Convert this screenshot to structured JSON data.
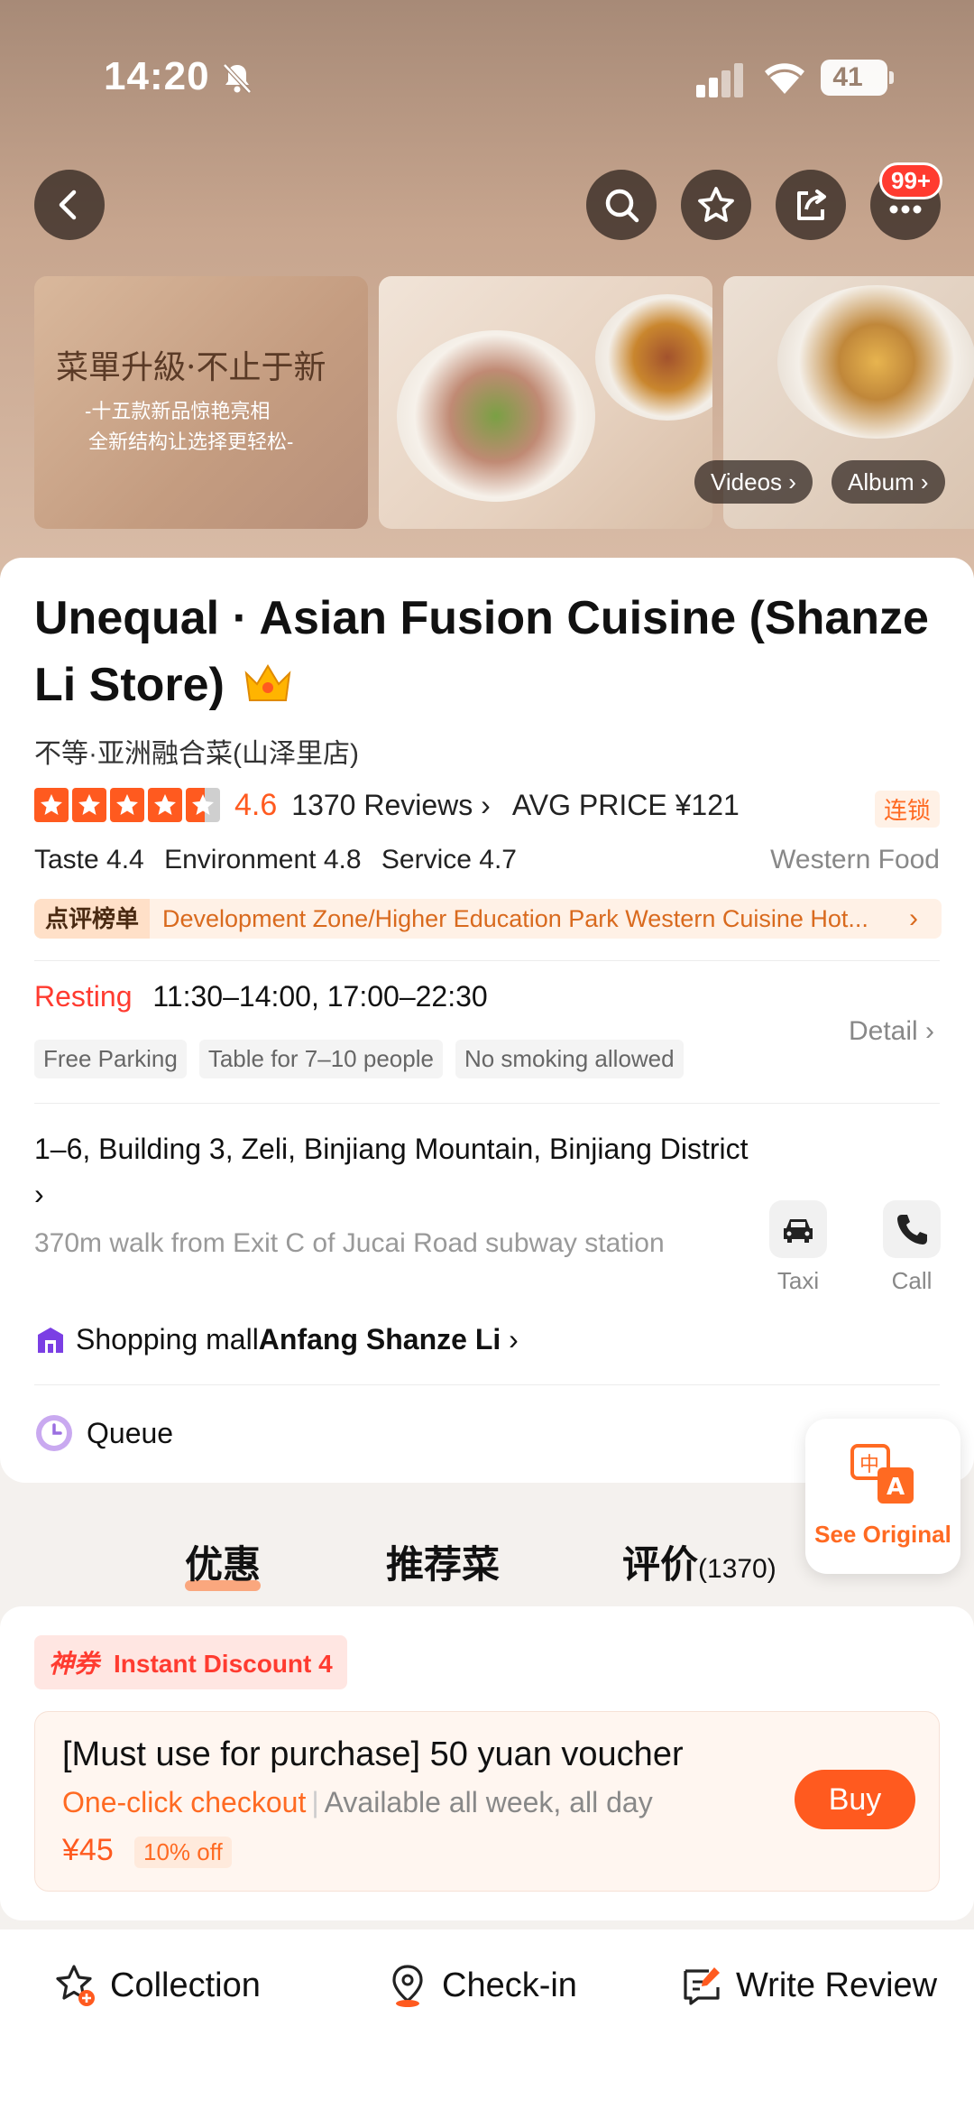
{
  "status_bar": {
    "time": "14:20",
    "battery": "41"
  },
  "header": {
    "more_badge": "99+"
  },
  "gallery": {
    "photo1_title": "菜單升級·不止于新",
    "photo1_line1": "-十五款新品惊艳亮相",
    "photo1_line2": "全新结构让选择更轻松-",
    "videos_label": "Videos",
    "album_label": "Album"
  },
  "shop": {
    "title": "Unequal · Asian Fusion Cuisine (Shanze Li Store)",
    "chinese_name": "不等·亚洲融合菜(山泽里店)",
    "rating": "4.6",
    "stars": 4.6,
    "reviews": "1370 Reviews",
    "avg_price": "AVG PRICE ¥121",
    "chain_tag": "连锁",
    "taste": "Taste 4.4",
    "environment": "Environment 4.8",
    "service": "Service 4.7",
    "cuisine": "Western Food",
    "rank_tag": "点评榜单",
    "rank_text": "Development Zone/Higher Education Park Western Cuisine Hot..."
  },
  "hours": {
    "status": "Resting",
    "time": "11:30–14:00, 17:00–22:30",
    "tags": [
      "Free Parking",
      "Table for 7–10 people",
      "No smoking allowed"
    ],
    "detail_label": "Detail"
  },
  "location": {
    "address": "1–6, Building 3, Zeli, Binjiang Mountain, Binjiang District",
    "walk": "370m walk from Exit C of Jucai Road subway station",
    "mall_prefix": "Shopping mall",
    "mall_name": "Anfang Shanze Li",
    "taxi_label": "Taxi",
    "call_label": "Call"
  },
  "queue": {
    "label": "Queue"
  },
  "translate": {
    "label": "See Original"
  },
  "tabs": [
    {
      "label": "优惠"
    },
    {
      "label": "推荐菜"
    },
    {
      "label": "评价",
      "count": "(1370)"
    }
  ],
  "deals": {
    "tag_prefix": "神券",
    "tag_label": "Instant Discount 4",
    "item": {
      "title": "[Must use for purchase] 50 yuan voucher",
      "checkout": "One-click checkout",
      "availability": "Available all week, all day",
      "price": "¥45",
      "discount": "10% off",
      "buy_label": "Buy"
    }
  },
  "bottom_bar": {
    "collection": "Collection",
    "checkin": "Check-in",
    "write_review": "Write Review"
  },
  "colors": {
    "accent": "#ff5a1f",
    "resting": "#ff3b30"
  }
}
